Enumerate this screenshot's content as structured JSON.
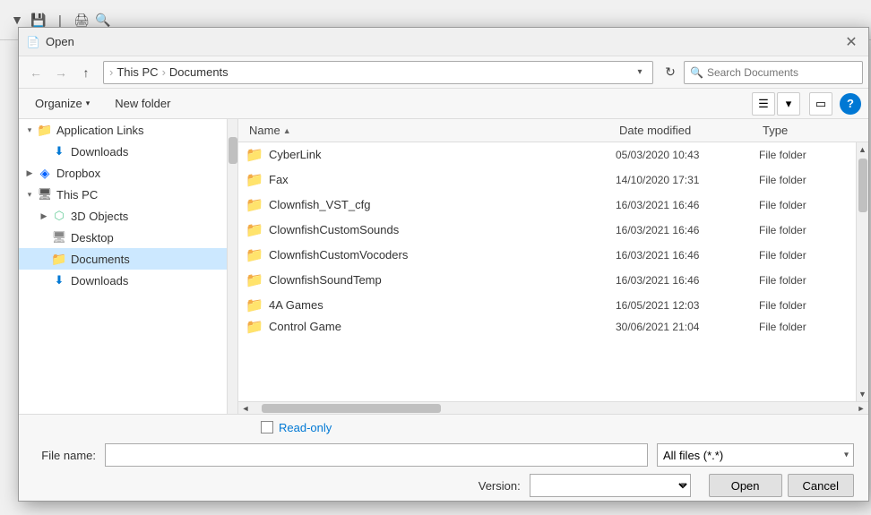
{
  "dialog": {
    "title": "Open",
    "title_icon": "📄"
  },
  "nav": {
    "back_label": "←",
    "forward_label": "→",
    "up_label": "↑",
    "path_parts": [
      "This PC",
      "Documents"
    ],
    "refresh_label": "↻",
    "search_placeholder": "Search Documents"
  },
  "toolbar2": {
    "organize_label": "Organize",
    "new_folder_label": "New folder",
    "help_label": "?"
  },
  "sidebar": {
    "items": [
      {
        "id": "application-links",
        "label": "Application Links",
        "indent": 0,
        "expanded": true,
        "icon": "folder",
        "selected": false
      },
      {
        "id": "downloads-sub",
        "label": "Downloads",
        "indent": 1,
        "expanded": false,
        "icon": "download",
        "selected": false
      },
      {
        "id": "dropbox",
        "label": "Dropbox",
        "indent": 0,
        "expanded": false,
        "icon": "dropbox",
        "selected": false
      },
      {
        "id": "this-pc",
        "label": "This PC",
        "indent": 0,
        "expanded": true,
        "icon": "pc",
        "selected": false
      },
      {
        "id": "3d-objects",
        "label": "3D Objects",
        "indent": 1,
        "expanded": false,
        "icon": "cube",
        "selected": false
      },
      {
        "id": "desktop",
        "label": "Desktop",
        "indent": 1,
        "expanded": false,
        "icon": "desktop",
        "selected": false
      },
      {
        "id": "documents",
        "label": "Documents",
        "indent": 1,
        "expanded": false,
        "icon": "folder",
        "selected": true
      },
      {
        "id": "downloads",
        "label": "Downloads",
        "indent": 1,
        "expanded": false,
        "icon": "download",
        "selected": false
      }
    ]
  },
  "file_list": {
    "columns": [
      {
        "id": "name",
        "label": "Name",
        "sort_arrow": "▲"
      },
      {
        "id": "date_modified",
        "label": "Date modified"
      },
      {
        "id": "type",
        "label": "Type"
      }
    ],
    "files": [
      {
        "name": "CyberLink",
        "date": "05/03/2020 10:43",
        "type": "File folder",
        "icon": "folder"
      },
      {
        "name": "Fax",
        "date": "14/10/2020 17:31",
        "type": "File folder",
        "icon": "folder"
      },
      {
        "name": "Clownfish_VST_cfg",
        "date": "16/03/2021 16:46",
        "type": "File folder",
        "icon": "folder"
      },
      {
        "name": "ClownfishCustomSounds",
        "date": "16/03/2021 16:46",
        "type": "File folder",
        "icon": "folder"
      },
      {
        "name": "ClownfishCustomVocoders",
        "date": "16/03/2021 16:46",
        "type": "File folder",
        "icon": "folder"
      },
      {
        "name": "ClownfishSoundTemp",
        "date": "16/03/2021 16:46",
        "type": "File folder",
        "icon": "folder"
      },
      {
        "name": "4A Games",
        "date": "16/05/2021 12:03",
        "type": "File folder",
        "icon": "folder"
      },
      {
        "name": "Control Game",
        "date": "30/06/2021 21:04",
        "type": "File folder",
        "icon": "folder"
      }
    ]
  },
  "bottom": {
    "readonly_label": "Read-only",
    "filename_label": "File name:",
    "filename_value": "",
    "filetype_label": "All files (*.*)",
    "version_label": "Version:",
    "version_value": "",
    "open_label": "Open",
    "cancel_label": "Cancel"
  }
}
